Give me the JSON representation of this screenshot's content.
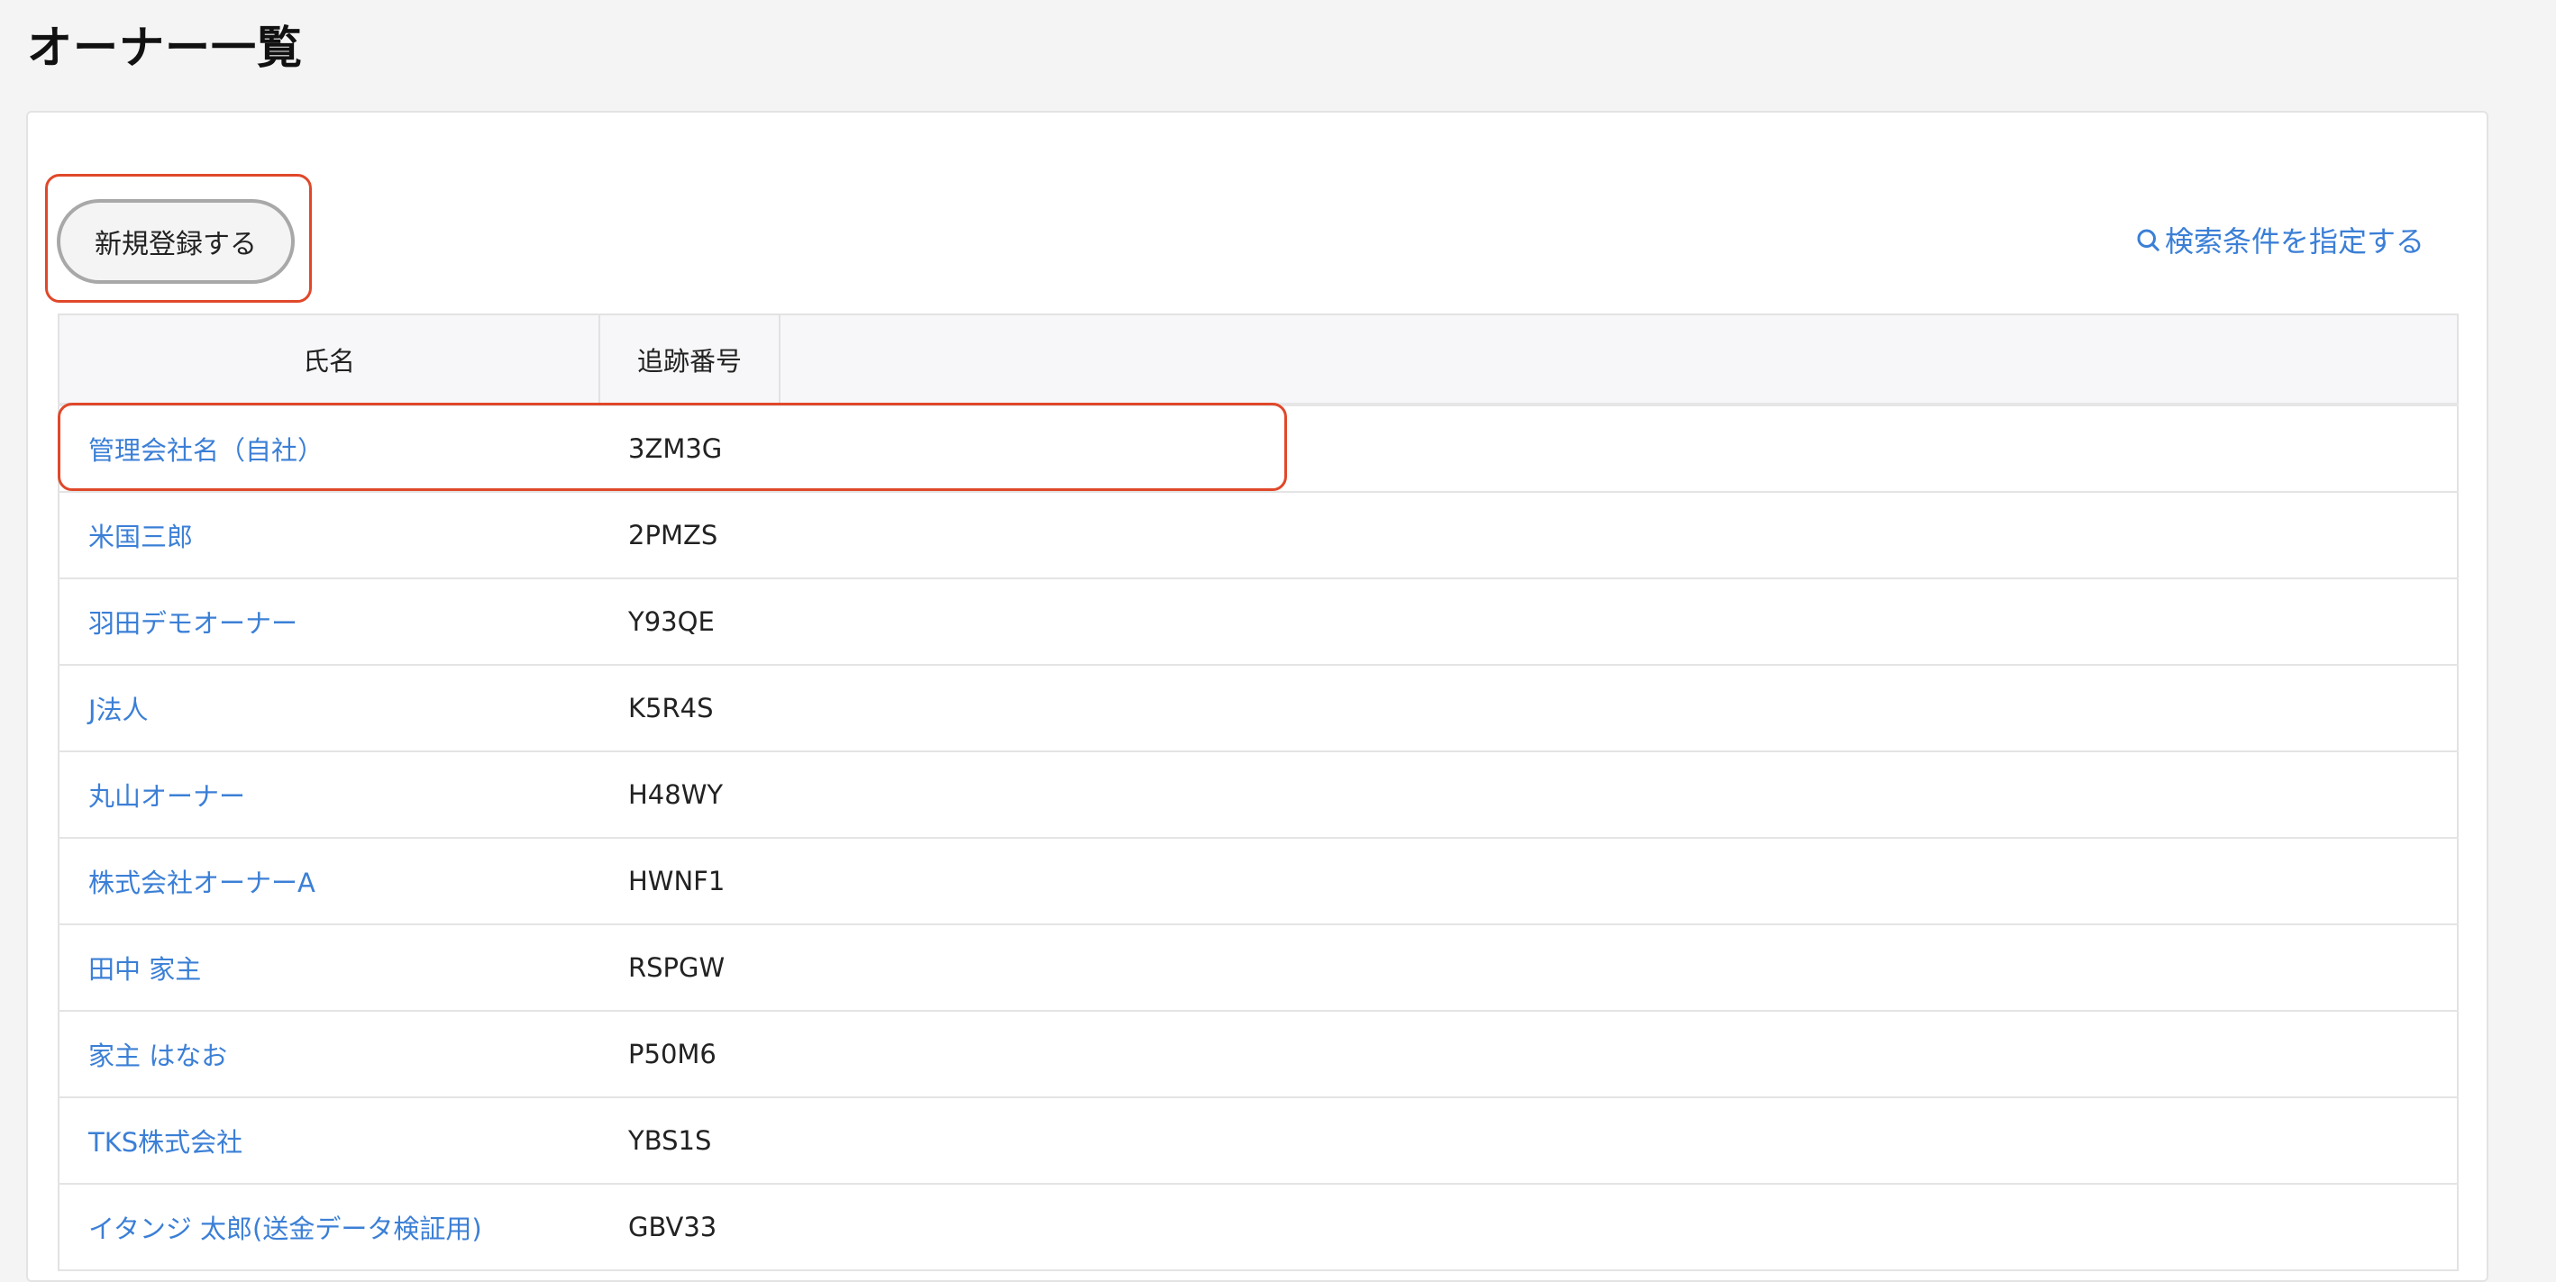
{
  "page": {
    "title": "オーナー一覧"
  },
  "toolbar": {
    "register_label": "新規登録する",
    "search_label": "検索条件を指定する",
    "search_icon": "search-icon"
  },
  "table": {
    "headers": {
      "name": "氏名",
      "tracking": "追跡番号"
    },
    "rows": [
      {
        "name": "管理会社名（自社）",
        "tracking": "3ZM3G"
      },
      {
        "name": "米国三郎",
        "tracking": "2PMZS"
      },
      {
        "name": "羽田デモオーナー",
        "tracking": "Y93QE"
      },
      {
        "name": "J法人",
        "tracking": "K5R4S"
      },
      {
        "name": "丸山オーナー",
        "tracking": "H48WY"
      },
      {
        "name": "株式会社オーナーA",
        "tracking": "HWNF1"
      },
      {
        "name": "田中 家主",
        "tracking": "RSPGW"
      },
      {
        "name": "家主 はなお",
        "tracking": "P50M6"
      },
      {
        "name": "TKS株式会社",
        "tracking": "YBS1S"
      },
      {
        "name": "イタンジ 太郎(送金データ検証用)",
        "tracking": "GBV33"
      }
    ]
  },
  "colors": {
    "link": "#3b7fd6",
    "highlight": "#e0482a",
    "background": "#f4f4f4"
  }
}
